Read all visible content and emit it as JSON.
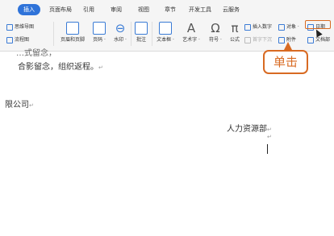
{
  "tabs": [
    "插入",
    "页面布局",
    "引用",
    "审阅",
    "视图",
    "章节",
    "开发工具",
    "云服务"
  ],
  "ribbon": {
    "left_small": [
      "思维导图",
      "流程图"
    ],
    "header_footer": "页眉和页脚",
    "page_number": "页码 ·",
    "watermark": "水印 ·",
    "comment": "批注",
    "textbox": "文本框 ·",
    "wordart": "艺术字 ·",
    "symbol": "符号 ·",
    "formula": "公式",
    "insert_number": "插入数字",
    "object": "对象 ·",
    "date": "日期",
    "first_letter_sink": "首字下沉",
    "attachment": "附件",
    "doc_parts": "文档部"
  },
  "callout": {
    "label": "单击"
  },
  "document": {
    "line1": "…式留念，",
    "line2": "合影留念，组织返程。",
    "line3": "限公司",
    "line4": "人力资源部",
    "para_mark": "↵"
  }
}
